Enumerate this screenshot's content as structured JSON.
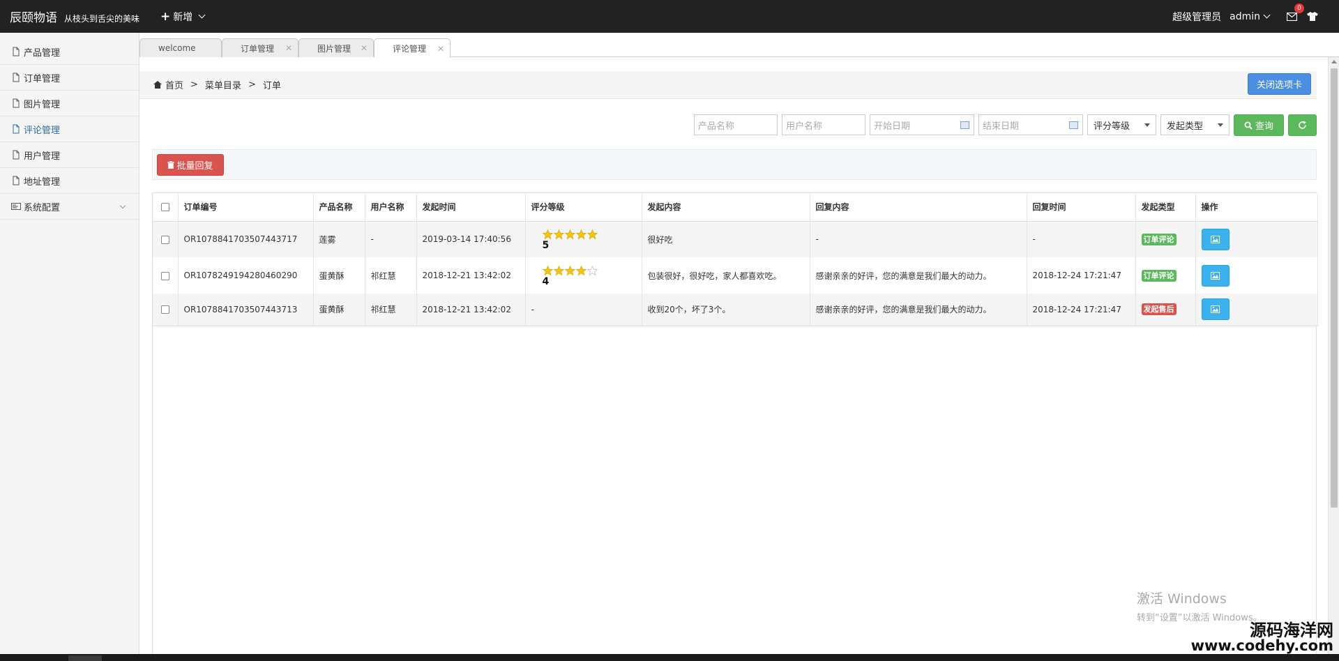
{
  "header": {
    "brand_name": "辰颐物语",
    "slogan": "从枝头到舌尖的美味",
    "add_label": "新增",
    "role": "超级管理员",
    "user": "admin",
    "mail_badge": "0"
  },
  "sidebar": {
    "items": [
      {
        "label": "产品管理"
      },
      {
        "label": "订单管理"
      },
      {
        "label": "图片管理"
      },
      {
        "label": "评论管理"
      },
      {
        "label": "用户管理"
      },
      {
        "label": "地址管理"
      },
      {
        "label": "系统配置"
      }
    ],
    "active_index": 3
  },
  "tabs": [
    {
      "label": "welcome"
    },
    {
      "label": "订单管理"
    },
    {
      "label": "图片管理"
    },
    {
      "label": "评论管理"
    }
  ],
  "breadcrumb": {
    "home": "首页",
    "sep": ">",
    "level1": "菜单目录",
    "level2": "订单",
    "close_tabs": "关闭选项卡"
  },
  "filters": {
    "product_placeholder": "产品名称",
    "user_placeholder": "用户名称",
    "start_placeholder": "开始日期",
    "end_placeholder": "结束日期",
    "rating_select": "评分等级",
    "type_select": "发起类型",
    "query_label": "查询"
  },
  "toolbar": {
    "batch_reply": "批量回复"
  },
  "table": {
    "headers": [
      "订单编号",
      "产品名称",
      "用户名称",
      "发起时间",
      "评分等级",
      "发起内容",
      "回复内容",
      "回复时间",
      "发起类型",
      "操作"
    ],
    "rows": [
      {
        "order_no": "OR1078841703507443717",
        "product": "莲雾",
        "user": "-",
        "time": "2019-03-14 17:40:56",
        "rating": 5,
        "rating_text": "5",
        "content": "很好吃",
        "reply": "-",
        "reply_time": "-",
        "type": "订单评论",
        "type_color": "#5cb85c"
      },
      {
        "order_no": "OR1078249194280460290",
        "product": "蛋黄酥",
        "user": "祁红慧",
        "time": "2018-12-21 13:42:02",
        "rating": 4,
        "rating_text": "4",
        "content": "包装很好，很好吃，家人都喜欢吃。",
        "reply": "感谢亲亲的好评，您的满意是我们最大的动力。",
        "reply_time": "2018-12-24 17:21:47",
        "type": "订单评论",
        "type_color": "#5cb85c"
      },
      {
        "order_no": "OR1078841703507443713",
        "product": "蛋黄酥",
        "user": "祁红慧",
        "time": "2018-12-21 13:42:02",
        "rating_text": "-",
        "content": "收到20个，坏了3个。",
        "reply": "感谢亲亲的好评，您的满意是我们最大的动力。",
        "reply_time": "2018-12-24 17:21:47",
        "type": "发起售后",
        "type_color": "#d9534f"
      }
    ]
  },
  "watermark": {
    "line1": "激活 Windows",
    "line2": "转到“设置”以激活 Windows。"
  },
  "site_mark": {
    "cn": "源码海洋网",
    "url": "www.codehy.com"
  },
  "colors": {
    "header_bg": "#222222",
    "accent_blue": "#4a8fe2",
    "success": "#5cb85c",
    "danger": "#d9534f",
    "info": "#3bb1ee",
    "star": "#f5c518"
  }
}
